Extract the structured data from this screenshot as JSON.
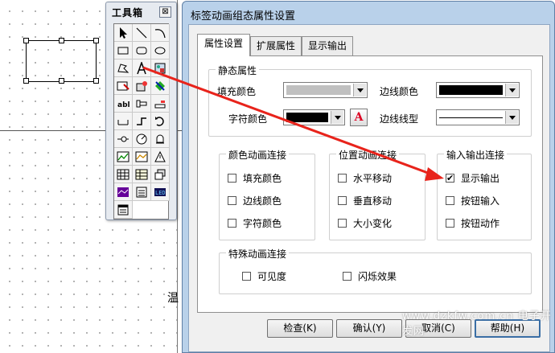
{
  "canvas": {
    "partial_text": "温"
  },
  "toolbox": {
    "title": "工具箱",
    "close_glyph": "⊠"
  },
  "dialog": {
    "title": "标签动画组态属性设置",
    "tabs": [
      {
        "label": "属性设置",
        "active": true
      },
      {
        "label": "扩展属性",
        "active": false
      },
      {
        "label": "显示输出",
        "active": false
      }
    ],
    "static_props": {
      "legend": "静态属性",
      "fill_color_label": "填充颜色",
      "border_color_label": "边线颜色",
      "char_color_label": "字符颜色",
      "border_style_label": "边线线型",
      "font_button_label": "A",
      "fill_color": "#c0c0c0",
      "border_color": "#000000",
      "char_color": "#000000"
    },
    "color_anim": {
      "legend": "颜色动画连接",
      "items": [
        {
          "label": "填充颜色",
          "checked": false
        },
        {
          "label": "边线颜色",
          "checked": false
        },
        {
          "label": "字符颜色",
          "checked": false
        }
      ]
    },
    "pos_anim": {
      "legend": "位置动画连接",
      "items": [
        {
          "label": "水平移动",
          "checked": false
        },
        {
          "label": "垂直移动",
          "checked": false
        },
        {
          "label": "大小变化",
          "checked": false
        }
      ]
    },
    "io_link": {
      "legend": "输入输出连接",
      "items": [
        {
          "label": "显示输出",
          "checked": true
        },
        {
          "label": "按钮输入",
          "checked": false
        },
        {
          "label": "按钮动作",
          "checked": false
        }
      ]
    },
    "special_anim": {
      "legend": "特殊动画连接",
      "items": [
        {
          "label": "可见度",
          "checked": false
        },
        {
          "label": "闪烁效果",
          "checked": false
        }
      ]
    },
    "buttons": {
      "check": "检查(K)",
      "ok": "确认(Y)",
      "cancel": "取消(C)",
      "help": "帮助(H)"
    }
  },
  "watermark": "www.dzkfw.com.cn 电子开发网",
  "colors": {
    "title_bar": "#b9d1ea",
    "annotation_arrow": "#e8231b"
  }
}
